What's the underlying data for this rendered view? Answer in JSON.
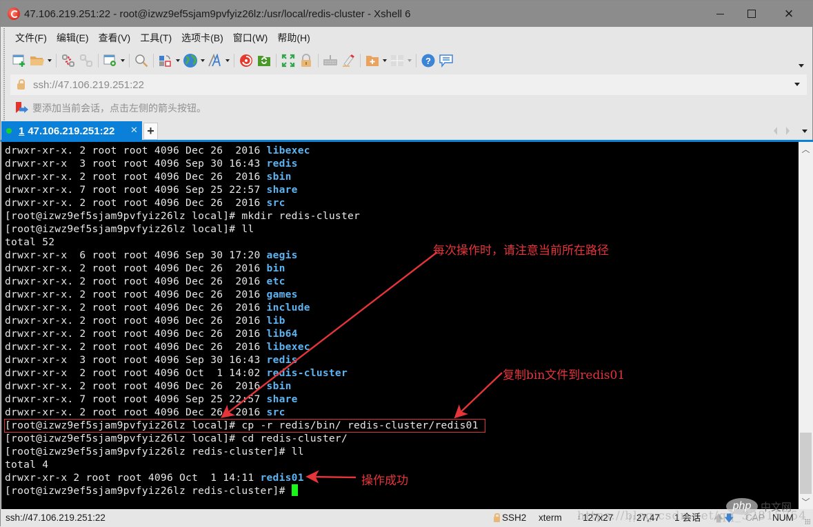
{
  "window": {
    "title": "47.106.219.251:22 - root@izwz9ef5sjam9pvfyiz26lz:/usr/local/redis-cluster - Xshell 6",
    "controls": {
      "minimize": "minimize",
      "maximize": "maximize",
      "close": "×"
    }
  },
  "menu": [
    {
      "label": "文件(F)"
    },
    {
      "label": "编辑(E)"
    },
    {
      "label": "查看(V)"
    },
    {
      "label": "工具(T)"
    },
    {
      "label": "选项卡(B)"
    },
    {
      "label": "窗口(W)"
    },
    {
      "label": "帮助(H)"
    }
  ],
  "toolbar": {
    "icons": [
      "new-session-icon",
      "open-folder-icon",
      "disconnect-icon",
      "reconnect-icon",
      "session-properties-icon",
      "find-icon",
      "layout-transfer-icon",
      "globe-icon",
      "font-icon",
      "xshell-icon",
      "xftp-icon",
      "fullscreen-icon",
      "lock-icon",
      "keyboard-icon",
      "highlight-pen-icon",
      "new-folder-icon",
      "tile-layout-icon",
      "help-icon",
      "chat-icon"
    ]
  },
  "address": {
    "value": "ssh://47.106.219.251:22"
  },
  "hint": {
    "text": "要添加当前会话，点击左侧的箭头按钮。"
  },
  "tabs": [
    {
      "number": "1",
      "label": "47.106.219.251:22",
      "active": true,
      "status_color": "#1bd12a"
    }
  ],
  "terminal": {
    "lines": [
      {
        "text": "drwxr-xr-x. 2 root root 4096 Dec 26  2016 ",
        "dir": "libexec"
      },
      {
        "text": "drwxr-xr-x  3 root root 4096 Sep 30 16:43 ",
        "dir": "redis"
      },
      {
        "text": "drwxr-xr-x. 2 root root 4096 Dec 26  2016 ",
        "dir": "sbin"
      },
      {
        "text": "drwxr-xr-x. 7 root root 4096 Sep 25 22:57 ",
        "dir": "share"
      },
      {
        "text": "drwxr-xr-x. 2 root root 4096 Dec 26  2016 ",
        "dir": "src"
      },
      {
        "text": "[root@izwz9ef5sjam9pvfyiz26lz local]# mkdir redis-cluster",
        "dir": ""
      },
      {
        "text": "[root@izwz9ef5sjam9pvfyiz26lz local]# ll",
        "dir": ""
      },
      {
        "text": "total 52",
        "dir": ""
      },
      {
        "text": "drwxr-xr-x  6 root root 4096 Sep 30 17:20 ",
        "dir": "aegis"
      },
      {
        "text": "drwxr-xr-x. 2 root root 4096 Dec 26  2016 ",
        "dir": "bin"
      },
      {
        "text": "drwxr-xr-x. 2 root root 4096 Dec 26  2016 ",
        "dir": "etc"
      },
      {
        "text": "drwxr-xr-x. 2 root root 4096 Dec 26  2016 ",
        "dir": "games"
      },
      {
        "text": "drwxr-xr-x. 2 root root 4096 Dec 26  2016 ",
        "dir": "include"
      },
      {
        "text": "drwxr-xr-x. 2 root root 4096 Dec 26  2016 ",
        "dir": "lib"
      },
      {
        "text": "drwxr-xr-x. 2 root root 4096 Dec 26  2016 ",
        "dir": "lib64"
      },
      {
        "text": "drwxr-xr-x. 2 root root 4096 Dec 26  2016 ",
        "dir": "libexec"
      },
      {
        "text": "drwxr-xr-x  3 root root 4096 Sep 30 16:43 ",
        "dir": "redis"
      },
      {
        "text": "drwxr-xr-x  2 root root 4096 Oct  1 14:02 ",
        "dir": "redis-cluster"
      },
      {
        "text": "drwxr-xr-x. 2 root root 4096 Dec 26  2016 ",
        "dir": "sbin"
      },
      {
        "text": "drwxr-xr-x. 7 root root 4096 Sep 25 22:57 ",
        "dir": "share"
      },
      {
        "text": "drwxr-xr-x. 2 root root 4096 Dec 26  2016 ",
        "dir": "src"
      },
      {
        "text": "[root@izwz9ef5sjam9pvfyiz26lz local]# cp -r redis/bin/ redis-cluster/redis01",
        "dir": ""
      },
      {
        "text": "[root@izwz9ef5sjam9pvfyiz26lz local]# cd redis-cluster/",
        "dir": ""
      },
      {
        "text": "[root@izwz9ef5sjam9pvfyiz26lz redis-cluster]# ll",
        "dir": ""
      },
      {
        "text": "total 4",
        "dir": ""
      },
      {
        "text": "drwxr-xr-x 2 root root 4096 Oct  1 14:11 ",
        "dir": "redis01"
      },
      {
        "text": "[root@izwz9ef5sjam9pvfyiz26lz redis-cluster]# ",
        "dir": "",
        "cursor": true
      }
    ],
    "colors": {
      "background": "#000000",
      "text": "#e8e8e8",
      "directory": "#5cb4f2",
      "cursor": "#1af61a"
    }
  },
  "annotations": {
    "path_note": "每次操作时，请注意当前所在路径",
    "copy_note": "复制bin文件到redis01",
    "success_note": "操作成功",
    "color": "#e6343b"
  },
  "statusbar": {
    "connection": "ssh://47.106.219.251:22",
    "protocol": "SSH2",
    "terminal_type": "xterm",
    "size": "127x27",
    "cursor_pos": "27,47",
    "sessions": "1 会话",
    "cap": "CAP",
    "num": "NUM"
  },
  "watermarks": {
    "url": "https://blog.csdn.net/qq_32815754",
    "php": "php",
    "php_cn": "中文网"
  }
}
